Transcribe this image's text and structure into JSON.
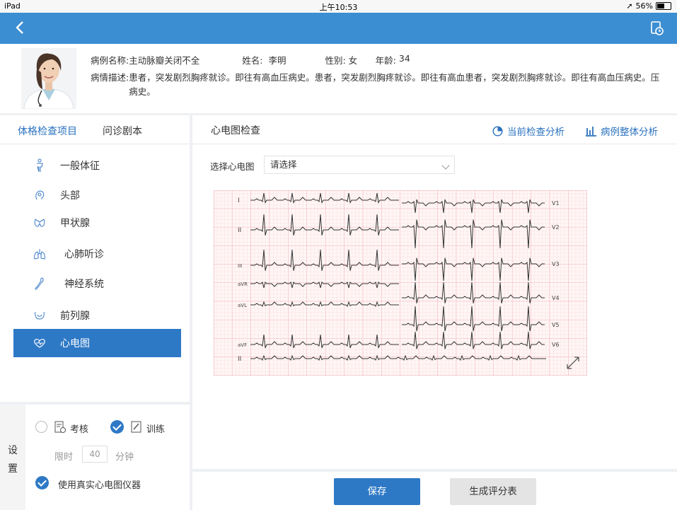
{
  "status": {
    "device": "iPad",
    "time": "上午10:53",
    "battery": "56%"
  },
  "patient": {
    "case_label": "病例名称:",
    "case_name": "主动脉瓣关闭不全",
    "name_label": "姓名:",
    "name": "李明",
    "gender_label": "性别:",
    "gender": "女",
    "age_label": "年龄:",
    "age": "34",
    "desc_label": "病情描述:",
    "description": "患者，突发剧烈胸疼就诊。即往有高血压病史。患者，突发剧烈胸疼就诊。即往有高血患者，突发剧烈胸疼就诊。即往有高血压病史。压病史。"
  },
  "left_tabs": [
    "体格检查项目",
    "问诊剧本"
  ],
  "menu": [
    {
      "label": "一般体征",
      "icon": "body-icon"
    },
    {
      "label": "头部",
      "icon": "head-icon"
    },
    {
      "label": "甲状腺",
      "icon": "thyroid-icon"
    },
    {
      "label": "心肺听诊",
      "icon": "lungs-icon"
    },
    {
      "label": "神经系统",
      "icon": "neuro-icon"
    },
    {
      "label": "前列腺",
      "icon": "prostate-icon"
    },
    {
      "label": "心电图",
      "icon": "heart-icon"
    }
  ],
  "settings": {
    "label": "设置",
    "exam": "考核",
    "train": "训练",
    "limit_label": "限时",
    "limit_value": "40",
    "limit_unit": "分钟",
    "real_device": "使用真实心电图仪器"
  },
  "main": {
    "title": "心电图检查",
    "link_current": "当前检查分析",
    "link_overall": "病例整体分析",
    "select_label": "选择心电图",
    "select_value": "请选择"
  },
  "ecg": {
    "left_leads": [
      "I",
      "II",
      "III",
      "aVR",
      "aVL",
      "aVF",
      "II"
    ],
    "right_leads": [
      "V1",
      "V2",
      "V3",
      "V4",
      "V5",
      "V6"
    ]
  },
  "buttons": {
    "save": "保存",
    "generate": "生成评分表"
  },
  "colors": {
    "primary": "#2e79c6",
    "nav": "#3c8ed2",
    "grid": "#f3a6ac"
  }
}
